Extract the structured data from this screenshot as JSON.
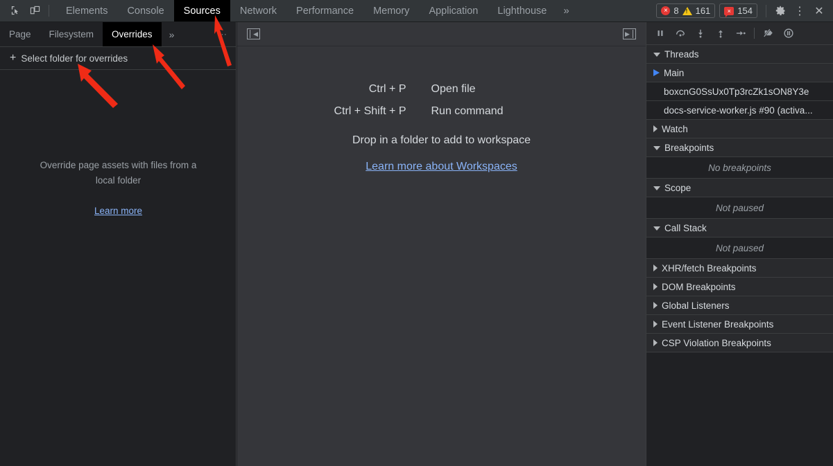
{
  "topbar": {
    "icons": [
      {
        "name": "inspect-element-icon",
        "glyph": "inspect"
      },
      {
        "name": "device-toolbar-icon",
        "glyph": "device"
      }
    ],
    "tabs": [
      {
        "label": "Elements",
        "active": false
      },
      {
        "label": "Console",
        "active": false
      },
      {
        "label": "Sources",
        "active": true
      },
      {
        "label": "Network",
        "active": false
      },
      {
        "label": "Performance",
        "active": false
      },
      {
        "label": "Memory",
        "active": false
      },
      {
        "label": "Application",
        "active": false
      },
      {
        "label": "Lighthouse",
        "active": false
      }
    ],
    "more_tabs_label": "»",
    "issues": {
      "error_count": "8",
      "warning_count": "161",
      "issue_count": "154",
      "error_glyph": "×",
      "issue_glyph": "×",
      "error_color": "#e53935",
      "warning_color": "#f5c518"
    },
    "settings_label": "⚙",
    "more_label": "⋮",
    "close_label": "✕"
  },
  "navigator": {
    "tabs": [
      {
        "label": "Page",
        "active": false
      },
      {
        "label": "Filesystem",
        "active": false
      },
      {
        "label": "Overrides",
        "active": true
      }
    ],
    "more_tabs_label": "»",
    "more_options_label": "⋯",
    "select_folder_label": "Select folder for overrides",
    "plus_label": "+",
    "empty_line1": "Override page assets with files from a",
    "empty_line2": "local folder",
    "learn_more_label": "Learn more"
  },
  "editor": {
    "collapse_left_label": "◀",
    "collapse_right_label": "▶",
    "shortcuts": [
      {
        "keys": "Ctrl + P",
        "desc": "Open file"
      },
      {
        "keys": "Ctrl + Shift + P",
        "desc": "Run command"
      }
    ],
    "drop_text": "Drop in a folder to add to workspace",
    "learn_more_label": "Learn more about Workspaces"
  },
  "debugger": {
    "toolbar": [
      {
        "name": "pause-script-button",
        "title": "Pause script execution"
      },
      {
        "name": "step-over-button",
        "title": "Step over next function call"
      },
      {
        "name": "step-into-button",
        "title": "Step into next function call"
      },
      {
        "name": "step-out-button",
        "title": "Step out of current function"
      },
      {
        "name": "step-button",
        "title": "Step"
      },
      {
        "name": "deactivate-breakpoints-button",
        "title": "Deactivate breakpoints"
      },
      {
        "name": "pause-on-exceptions-button",
        "title": "Pause on exceptions"
      }
    ],
    "sections": [
      {
        "title": "Threads",
        "expanded": true,
        "rows": [
          {
            "label": "Main",
            "selected": true,
            "current": true
          },
          {
            "label": "boxcnG0SsUx0Tp3rcZk1sON8Y3e",
            "selected": false,
            "current": false
          },
          {
            "label": "docs-service-worker.js #90 (activa...",
            "selected": false,
            "current": false
          }
        ]
      },
      {
        "title": "Watch",
        "expanded": false,
        "rows": []
      },
      {
        "title": "Breakpoints",
        "expanded": true,
        "empty_note": "No breakpoints"
      },
      {
        "title": "Scope",
        "expanded": true,
        "empty_note": "Not paused"
      },
      {
        "title": "Call Stack",
        "expanded": true,
        "empty_note": "Not paused"
      },
      {
        "title": "XHR/fetch Breakpoints",
        "expanded": false
      },
      {
        "title": "DOM Breakpoints",
        "expanded": false
      },
      {
        "title": "Global Listeners",
        "expanded": false
      },
      {
        "title": "Event Listener Breakpoints",
        "expanded": false
      },
      {
        "title": "CSP Violation Breakpoints",
        "expanded": false
      }
    ]
  },
  "annotations": {
    "arrow_color": "#ef2b16",
    "arrows": [
      {
        "name": "arrow-to-sources-tab"
      },
      {
        "name": "arrow-to-overrides-tab"
      },
      {
        "name": "arrow-to-select-folder"
      }
    ]
  }
}
